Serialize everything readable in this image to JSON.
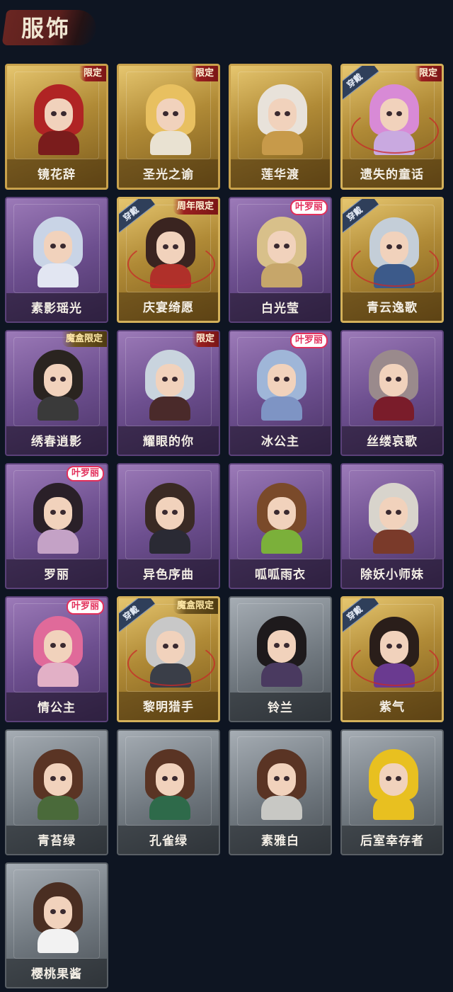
{
  "page": {
    "title": "服饰"
  },
  "items": [
    {
      "name": "镜花辞",
      "tier": "gold",
      "badge": "限定",
      "badge_style": "red",
      "worn": false,
      "hair": "#b02424",
      "body": "#7a1c1c"
    },
    {
      "name": "圣光之谕",
      "tier": "gold",
      "badge": "限定",
      "badge_style": "red",
      "worn": false,
      "hair": "#e8c060",
      "body": "#e9e2d2"
    },
    {
      "name": "莲华渡",
      "tier": "gold",
      "badge": "",
      "badge_style": "red",
      "worn": false,
      "hair": "#e8e2da",
      "body": "#c79a4a"
    },
    {
      "name": "遗失的童话",
      "tier": "gold",
      "badge": "限定",
      "badge_style": "red",
      "worn": true,
      "hair": "#d88ad6",
      "body": "#c9a9e0"
    },
    {
      "name": "素影瑶光",
      "tier": "purple",
      "badge": "",
      "badge_style": "red",
      "worn": false,
      "hair": "#c9d4e6",
      "body": "#e2e6f2"
    },
    {
      "name": "庆宴绮愿",
      "tier": "gold",
      "badge": "周年限定",
      "badge_style": "red",
      "worn": true,
      "hair": "#3a2420",
      "body": "#b0302a"
    },
    {
      "name": "白光莹",
      "tier": "purple",
      "badge": "叶罗丽",
      "badge_style": "pink",
      "worn": false,
      "hair": "#d8c08a",
      "body": "#c6a66a"
    },
    {
      "name": "青云逸歌",
      "tier": "gold",
      "badge": "",
      "badge_style": "red",
      "worn": true,
      "hair": "#c4ced8",
      "body": "#3c5a8a"
    },
    {
      "name": "绣春逍影",
      "tier": "purple",
      "badge": "魔盒限定",
      "badge_style": "box",
      "worn": false,
      "hair": "#2a2420",
      "body": "#3a3a3a"
    },
    {
      "name": "耀眼的你",
      "tier": "purple",
      "badge": "限定",
      "badge_style": "red",
      "worn": false,
      "hair": "#c9d4de",
      "body": "#4a2a2a"
    },
    {
      "name": "冰公主",
      "tier": "purple",
      "badge": "叶罗丽",
      "badge_style": "pink",
      "worn": false,
      "hair": "#9fb6d8",
      "body": "#7e94c4"
    },
    {
      "name": "丝缕哀歌",
      "tier": "purple",
      "badge": "",
      "badge_style": "red",
      "worn": false,
      "hair": "#9a8a8c",
      "body": "#7a1c2a"
    },
    {
      "name": "罗丽",
      "tier": "purple",
      "badge": "叶罗丽",
      "badge_style": "pink",
      "worn": false,
      "hair": "#2a2028",
      "body": "#c4a2c6"
    },
    {
      "name": "异色序曲",
      "tier": "purple",
      "badge": "",
      "badge_style": "red",
      "worn": false,
      "hair": "#3a2a24",
      "body": "#2a2a34"
    },
    {
      "name": "呱呱雨衣",
      "tier": "purple",
      "badge": "",
      "badge_style": "red",
      "worn": false,
      "hair": "#7a4a2a",
      "body": "#7bb03a"
    },
    {
      "name": "除妖小师妹",
      "tier": "purple",
      "badge": "",
      "badge_style": "red",
      "worn": false,
      "hair": "#d8d4cc",
      "body": "#7a3a2a"
    },
    {
      "name": "情公主",
      "tier": "purple",
      "badge": "叶罗丽",
      "badge_style": "pink",
      "worn": false,
      "hair": "#e06a9a",
      "body": "#e2b0c6"
    },
    {
      "name": "黎明猎手",
      "tier": "gold",
      "badge": "魔盒限定",
      "badge_style": "box",
      "worn": true,
      "hair": "#c8c8c8",
      "body": "#3a3e48"
    },
    {
      "name": "铃兰",
      "tier": "gray",
      "badge": "",
      "badge_style": "red",
      "worn": false,
      "hair": "#1e1a1c",
      "body": "#4a3a60"
    },
    {
      "name": "紫气",
      "tier": "gold",
      "badge": "",
      "badge_style": "red",
      "worn": true,
      "hair": "#2a1e1a",
      "body": "#6a3a90"
    },
    {
      "name": "青苔绿",
      "tier": "gray",
      "badge": "",
      "badge_style": "red",
      "worn": false,
      "hair": "#5a3424",
      "body": "#4a6a3a"
    },
    {
      "name": "孔雀绿",
      "tier": "gray",
      "badge": "",
      "badge_style": "red",
      "worn": false,
      "hair": "#5a3424",
      "body": "#2e6a4a"
    },
    {
      "name": "素雅白",
      "tier": "gray",
      "badge": "",
      "badge_style": "red",
      "worn": false,
      "hair": "#5a3424",
      "body": "#c8c8c4"
    },
    {
      "name": "后室幸存者",
      "tier": "gray",
      "badge": "",
      "badge_style": "red",
      "worn": false,
      "hair": "#e8c020",
      "body": "#e8c020"
    },
    {
      "name": "樱桃果酱",
      "tier": "gray",
      "badge": "",
      "badge_style": "red",
      "worn": false,
      "hair": "#4a2e22",
      "body": "#f2f2f2"
    }
  ],
  "worn_label": "穿戴",
  "colors": {
    "background": "#0e1522",
    "gold": "#c9a24c",
    "purple": "#6d4f8f",
    "gray": "#6f777e"
  }
}
